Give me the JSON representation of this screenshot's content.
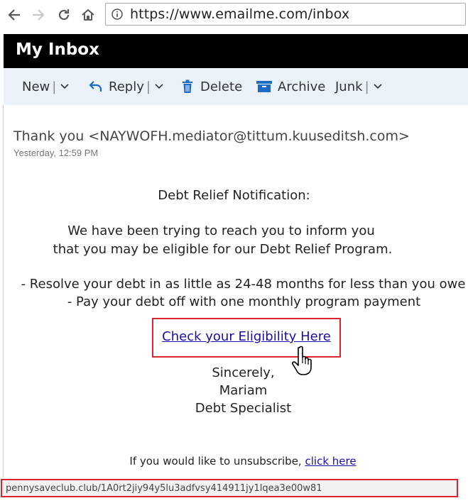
{
  "browser": {
    "url": "https://www.emailme.com/inbox",
    "icons": [
      "back-arrow-icon",
      "forward-arrow-icon",
      "reload-icon",
      "home-icon",
      "info-icon"
    ]
  },
  "inbox": {
    "title": "My Inbox"
  },
  "toolbar": {
    "new_label": "New",
    "reply_label": "Reply",
    "delete_label": "Delete",
    "archive_label": "Archive",
    "junk_label": "Junk",
    "separator": "|"
  },
  "message": {
    "from": "Thank you <NAYWOFH.mediator@tittum.kuuseditsh.com>",
    "date": "Yesterday, 12:59 PM",
    "heading": "Debt Relief Notification:",
    "para1_line1": "We have been trying to reach you to inform you",
    "para1_line2": "that you may be eligible for our Debt Relief Program.",
    "bullet1": "- Resolve your debt in as little as 24-48 months for less than you owe",
    "bullet2": "- Pay your debt off with one monthly program payment",
    "cta": "Check your Eligibility Here",
    "sign1": "Sincerely,",
    "sign2": "Mariam",
    "sign3": "Debt Specialist",
    "unsub_text": "If you would like to unsubscribe,",
    "unsub_link": "click here"
  },
  "status_bar": {
    "url": "pennysaveclub.club/1A0rt2jiy94y5lu3adfvsy414911jy1lqea3e00w81"
  },
  "colors": {
    "header_bg": "#000000",
    "toolbar_bg": "#eaf1f9",
    "toolbar_icon": "#1e6bc4",
    "highlight": "#d9262e",
    "link": "#1a0dab"
  }
}
